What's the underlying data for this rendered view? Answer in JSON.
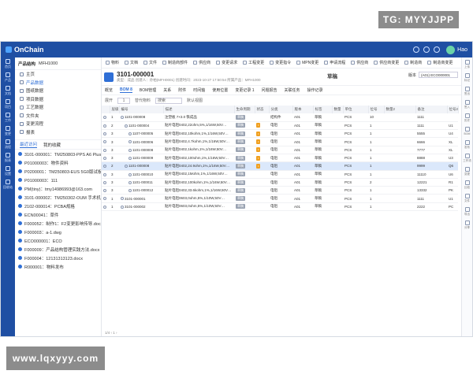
{
  "watermark_top": "TG: MYYJJPP",
  "watermark_bottom": "www.lqxyyy.com",
  "app": {
    "logo": "OnChain",
    "user": "Hao"
  },
  "leftnav": [
    "首页",
    "产品",
    "文档",
    "项目",
    "工作",
    "变更",
    "流程",
    "报表",
    "设置",
    "回收站"
  ],
  "tree": {
    "title": "产品结构",
    "subtitle": "MFH1000",
    "items": [
      "主页",
      "产品数据",
      "图纸数据",
      "项目数据",
      "工艺数据",
      "文件夹",
      "变更流程",
      "报表"
    ],
    "active_index": 1,
    "tabs": [
      "最近访问",
      "我的收藏"
    ],
    "recent": [
      "3101-000001：TM250803-PPS A6 Plus 底…",
      "P01000003：物件资料",
      "P0200001：TM250803-EUS 5G0版试板",
      "P01000003：111",
      "PM(tiny)：tmy14986993@163.com",
      "3101-000002：TM250302-OUM 手术机器人",
      "2102-000014：PCBA规格",
      "ECN00041：草件",
      "F000052：制作1：F2变更影响传导.docx",
      "F000003：a-1.dwg",
      "ECO000001：ECO",
      "F000009：产品结构管理实践方法.docx",
      "F000004：12131313123.docx",
      "R000001：物料发布"
    ]
  },
  "toolbar": [
    "物料",
    "文档",
    "文件",
    "制造商部件",
    "供应商",
    "变更请求",
    "工程变更",
    "变更指令",
    "MPN变更",
    "申请流程",
    "供应商",
    "供应商变更",
    "制造商",
    "制造商变更"
  ],
  "part": {
    "number": "3101-000001",
    "meta": "类型：成品    创建人：孙柏(MFH0001)    创建时间：2023-10-27 17:50:54    所属产品：MFH1000",
    "state": "草稿",
    "version_label": "版本",
    "version": "(A01) ECO000001"
  },
  "subtabs": [
    "概览",
    "BOM 8",
    "BOM管理",
    "关系",
    "附件",
    "时间轴",
    "使用位置",
    "变更记录 1",
    "问题报告",
    "关联任务",
    "操作记录"
  ],
  "active_subtab": 1,
  "actions": {
    "expand": "展开",
    "level": "1",
    "replace": "替代物料",
    "search_placeholder": "搜索",
    "view": "默认视图"
  },
  "table": {
    "headers": [
      "",
      "层级",
      "编号",
      "描述",
      "生命周期",
      "状态",
      "分类",
      "版本",
      "标签",
      "数量",
      "单位",
      "位号",
      "数量2",
      "备注",
      "位号2"
    ],
    "rows": [
      {
        "lvl": "1",
        "num": "1101-000008",
        "desc": "注塑板 7×3.0 铁成品",
        "life": "草稿",
        "state": "",
        "cat": "结构件",
        "ver": "A01",
        "tag": "草稿",
        "unit": "PCS",
        "qty": "10",
        "ref": "1111",
        "x": "",
        "sel": false
      },
      {
        "lvl": "2",
        "num": "1101-000004",
        "desc": "贴片电阻0402,22ohm,5%,1/16W,50V…",
        "life": "草稿",
        "state": "orange",
        "cat": "电阻",
        "ver": "A01",
        "tag": "草稿",
        "unit": "PCS",
        "qty": "1",
        "ref": "1111",
        "x": "U1",
        "sel": false
      },
      {
        "lvl": "3",
        "num": "1107-000005",
        "desc": "贴片电阻0402,10kohm,1%,1/16W,50V…",
        "life": "草稿",
        "state": "orange",
        "cat": "电阻",
        "ver": "A01",
        "tag": "草稿",
        "unit": "PCS",
        "qty": "1",
        "ref": "5555",
        "x": "U4",
        "sel": false
      },
      {
        "lvl": "3",
        "num": "1101-000006",
        "desc": "贴片电阻0402,4.7kohm,1%,1/16W,50V…",
        "life": "草稿",
        "state": "orange",
        "cat": "电阻",
        "ver": "A01",
        "tag": "草稿",
        "unit": "PCS",
        "qty": "1",
        "ref": "6666",
        "x": "XL",
        "sel": false
      },
      {
        "lvl": "3",
        "num": "1101-000008",
        "desc": "贴片电阻0402,1kohm,1%,1/16W,50V…",
        "life": "草稿",
        "state": "orange",
        "cat": "电阻",
        "ver": "A01",
        "tag": "草稿",
        "unit": "PCS",
        "qty": "1",
        "ref": "7777",
        "x": "XL",
        "sel": false
      },
      {
        "lvl": "3",
        "num": "1101-000009",
        "desc": "贴片电阻0402,100ohm,1%,1/16W,50V…",
        "life": "草稿",
        "state": "orange",
        "cat": "电阻",
        "ver": "A01",
        "tag": "草稿",
        "unit": "PCS",
        "qty": "1",
        "ref": "8888",
        "x": "U3",
        "sel": false
      },
      {
        "lvl": "2",
        "num": "1101-000008",
        "desc": "贴片电阻0402,24.9ohm,1%,1/16W,50V…",
        "life": "草稿",
        "state": "orange",
        "cat": "电阻",
        "ver": "A01",
        "tag": "草稿",
        "unit": "PCS",
        "qty": "1",
        "ref": "9999",
        "x": "Q6",
        "sel": true
      },
      {
        "lvl": "3",
        "num": "1101-000010",
        "desc": "贴片电阻0402,1Mohm,1%,1/16W,50V…",
        "life": "草稿",
        "state": "",
        "cat": "电阻",
        "ver": "A01",
        "tag": "草稿",
        "unit": "PCS",
        "qty": "1",
        "ref": "11110",
        "x": "U6",
        "sel": false
      },
      {
        "lvl": "3",
        "num": "1101-000011",
        "desc": "贴片电阻0402,100kohm,1%,1/16W,50V…",
        "life": "草稿",
        "state": "",
        "cat": "电阻",
        "ver": "A01",
        "tag": "草稿",
        "unit": "PCS",
        "qty": "2",
        "ref": "12221",
        "x": "R1",
        "sel": false
      },
      {
        "lvl": "3",
        "num": "1101-000012",
        "desc": "贴片电阻0402,33.6kohm,1%,1/16W,50V…",
        "life": "草稿",
        "state": "",
        "cat": "电阻",
        "ver": "A01",
        "tag": "草稿",
        "unit": "PCS",
        "qty": "1",
        "ref": "13332",
        "x": "PK",
        "sel": false
      },
      {
        "lvl": "1",
        "num": "3101-000001",
        "desc": "贴片电阻0603,0ohm,5%,1/10W,50V…",
        "life": "草稿",
        "state": "",
        "cat": "电阻",
        "ver": "A01",
        "tag": "草稿",
        "unit": "PCS",
        "qty": "1",
        "ref": "1111",
        "x": "U1",
        "sel": false
      },
      {
        "lvl": "1",
        "num": "3101-000002",
        "desc": "贴片电阻0603,0ohm,5%,1/10W,50V…",
        "life": "草稿",
        "state": "",
        "cat": "电阻",
        "ver": "A01",
        "tag": "草稿",
        "unit": "PCS",
        "qty": "1",
        "ref": "2222",
        "x": "PC",
        "sel": false
      }
    ]
  },
  "pager": "1/4  ‹  1  ›",
  "rightbar": [
    "上传",
    "标记",
    "签出",
    "签入",
    "历史",
    "BOM",
    "发布",
    "工作流",
    "变更",
    "比较",
    "文件",
    "导出",
    "分享"
  ]
}
